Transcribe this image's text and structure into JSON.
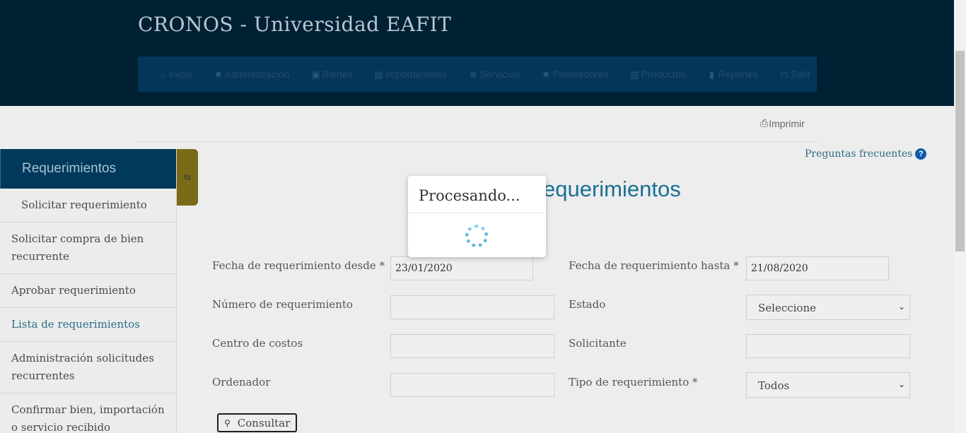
{
  "header": {
    "title": "CRONOS - Universidad EAFIT",
    "nav": [
      {
        "label": "Inicio",
        "icon": "home-icon"
      },
      {
        "label": "Administración",
        "icon": "gear-icon"
      },
      {
        "label": "Bienes",
        "icon": "cart-icon"
      },
      {
        "label": "Importaciones",
        "icon": "card-icon"
      },
      {
        "label": "Servicios",
        "icon": "plus-circle-icon"
      },
      {
        "label": "Proveedores",
        "icon": "gear-icon"
      },
      {
        "label": "Productos",
        "icon": "barcode-icon"
      },
      {
        "label": "Reportes",
        "icon": "bar-chart-icon"
      },
      {
        "label": "Salir",
        "icon": "power-icon"
      }
    ]
  },
  "toolbar": {
    "print_label": "Imprimir",
    "faq_label": "Preguntas frecuentes"
  },
  "sidebar": {
    "title": "Requerimientos",
    "items": [
      {
        "label": "Solicitar requerimiento"
      },
      {
        "label": "Solicitar compra de bien recurrente"
      },
      {
        "label": "Aprobar requerimiento"
      },
      {
        "label": "Lista de requerimientos"
      },
      {
        "label": "Administración solicitudes recurrentes"
      },
      {
        "label": "Confirmar bien, importación o servicio recibido"
      }
    ]
  },
  "main": {
    "heading": "equerimientos"
  },
  "form": {
    "fecha_desde": {
      "label": "Fecha de requerimiento desde *",
      "value": "23/01/2020"
    },
    "fecha_hasta": {
      "label": "Fecha de requerimiento hasta *",
      "value": "21/08/2020"
    },
    "numero": {
      "label": "Número de requerimiento",
      "value": ""
    },
    "estado": {
      "label": "Estado",
      "value": "Seleccione"
    },
    "centro_costos": {
      "label": "Centro de costos",
      "value": ""
    },
    "solicitante": {
      "label": "Solicitante",
      "value": ""
    },
    "ordenador": {
      "label": "Ordenador",
      "value": ""
    },
    "tipo": {
      "label": "Tipo de requerimiento *",
      "value": "Todos"
    },
    "consultar_label": "Consultar"
  },
  "modal": {
    "title": "Procesando..."
  },
  "colors": {
    "header_bg": "#002133",
    "navbar_bg": "#02375a",
    "sidebar_header_bg": "#00395c",
    "link": "#2d6f89",
    "overlay": "#ededed"
  }
}
